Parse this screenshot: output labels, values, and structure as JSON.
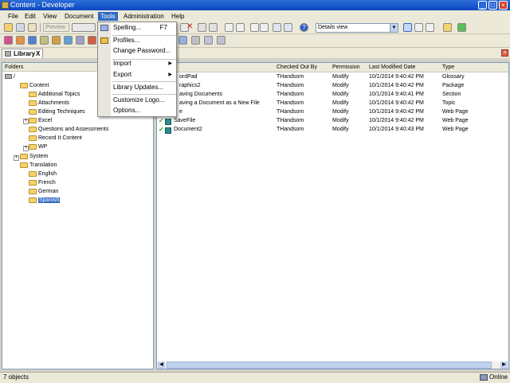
{
  "window": {
    "title": "Content - Developer"
  },
  "menubar": {
    "items": [
      "File",
      "Edit",
      "View",
      "Document",
      "Tools",
      "Administration",
      "Help"
    ],
    "active": "Tools"
  },
  "toolbar": {
    "preview_label": "Preview",
    "view_select": "Details view"
  },
  "tab": {
    "label": "Library",
    "close": "X"
  },
  "folders": {
    "header": "Folders",
    "tree": [
      {
        "label": "/"
      },
      {
        "label": "Content"
      },
      {
        "label": "Additional Topics"
      },
      {
        "label": "Attachments"
      },
      {
        "label": "Editing Techniques"
      },
      {
        "label": "Excel"
      },
      {
        "label": "Questions and Assessments"
      },
      {
        "label": "Record It Content"
      },
      {
        "label": "WP"
      },
      {
        "label": "System"
      },
      {
        "label": "Translation"
      },
      {
        "label": "English"
      },
      {
        "label": "French"
      },
      {
        "label": "German"
      },
      {
        "label": "Spanish"
      }
    ]
  },
  "list": {
    "columns": [
      "Checked Out By",
      "Permission",
      "Last Modified Date",
      "Type"
    ],
    "rows": [
      {
        "name": "ordPad",
        "checked": "THandsom",
        "perm": "Modify",
        "date": "10/1/2014 9:40:42 PM",
        "type": "Glossary"
      },
      {
        "name": "raphics2",
        "checked": "THandsom",
        "perm": "Modify",
        "date": "10/1/2014 9:40:42 PM",
        "type": "Package"
      },
      {
        "name": "aving Documents",
        "checked": "THandsom",
        "perm": "Modify",
        "date": "10/1/2014 9:40:41 PM",
        "type": "Section"
      },
      {
        "name": "aving a Document as a New File",
        "checked": "THandsom",
        "perm": "Modify",
        "date": "10/1/2014 9:40:42 PM",
        "type": "Topic"
      },
      {
        "name": "e",
        "checked": "THandsom",
        "perm": "Modify",
        "date": "10/1/2014 9:40:42 PM",
        "type": "Web Page"
      },
      {
        "name": "SaveFile",
        "checked": "THandsom",
        "perm": "Modify",
        "date": "10/1/2014 9:40:42 PM",
        "type": "Web Page"
      },
      {
        "name": "Document2",
        "checked": "THandsom",
        "perm": "Modify",
        "date": "10/1/2014 9:40:43 PM",
        "type": "Web Page"
      }
    ]
  },
  "tools_menu": {
    "spelling": "Spelling...",
    "spelling_shortcut": "F7",
    "profiles": "Profiles...",
    "change_password": "Change Password...",
    "import": "Import",
    "export": "Export",
    "library_updates": "Library Updates...",
    "customize_logo": "Customize Logo...",
    "options": "Options..."
  },
  "status": {
    "count": "7 objects",
    "connection": "Online"
  }
}
